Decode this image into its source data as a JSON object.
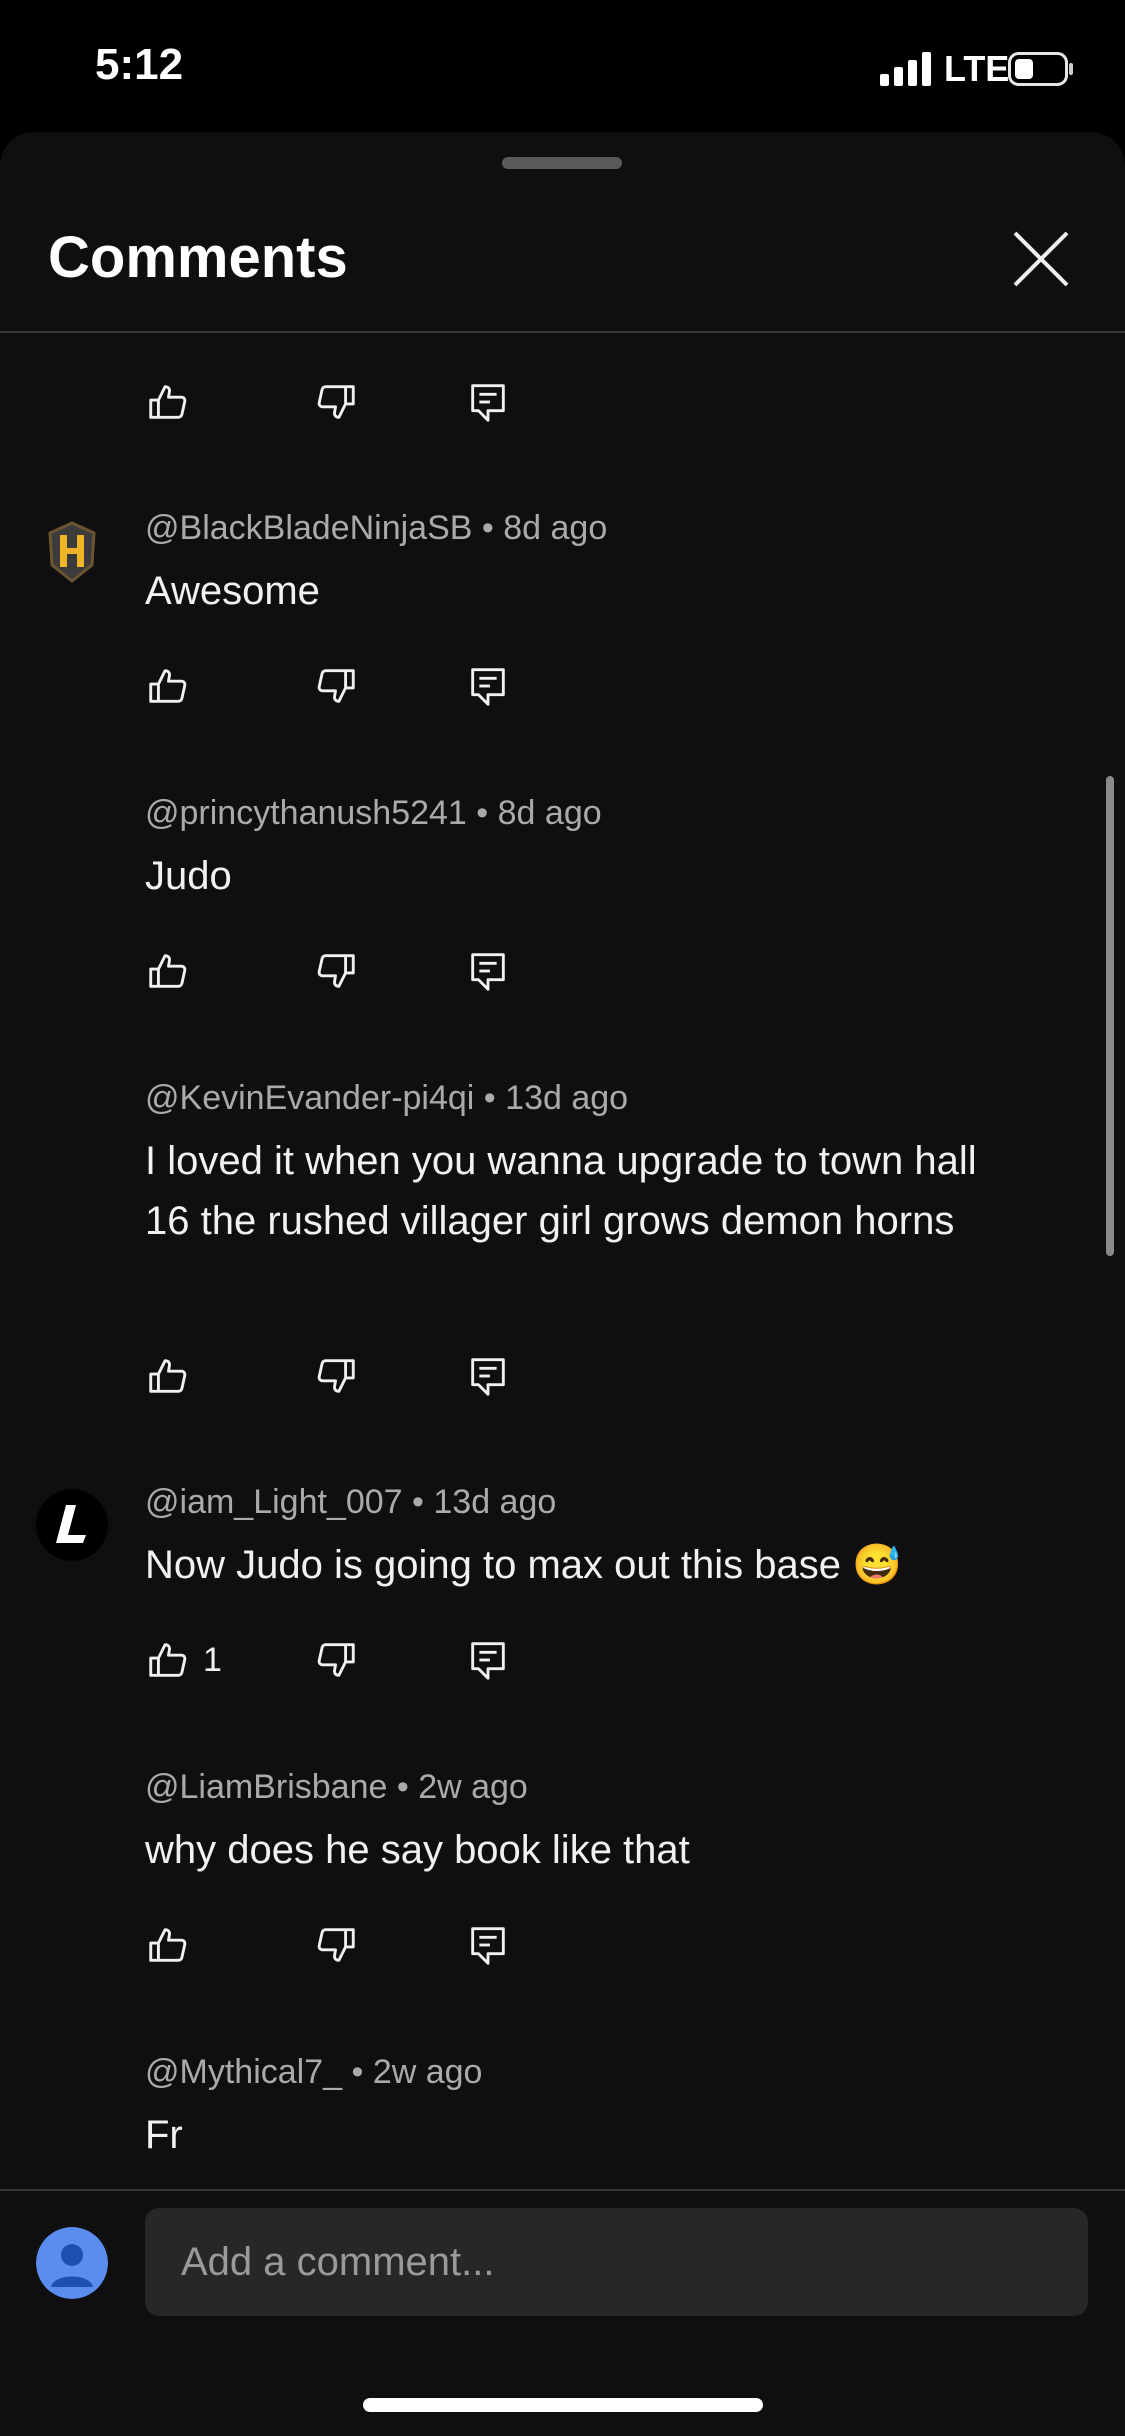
{
  "status_bar": {
    "time": "5:12",
    "network": "LTE"
  },
  "sheet": {
    "title": "Comments"
  },
  "comments": [
    {
      "user": "@BlackBladeNinjaSB",
      "age": "8d ago",
      "text": "Awesome"
    },
    {
      "user": "@princythanush5241",
      "age": "8d ago",
      "text": "Judo"
    },
    {
      "user": "@KevinEvander-pi4qi",
      "age": "13d ago",
      "text": "I loved it when you wanna upgrade to town hall 16 the rushed villager girl grows demon horns"
    },
    {
      "user": "@iam_Light_007",
      "age": "13d ago",
      "text": "Now Judo is going to max out this base 😅",
      "likes": "1"
    },
    {
      "user": "@LiamBrisbane",
      "age": "2w ago",
      "text": "why does he say book like that"
    },
    {
      "user": "@Mythical7_",
      "age": "2w ago",
      "text": "Fr"
    }
  ],
  "composer": {
    "placeholder": "Add a comment..."
  },
  "colors": {
    "background": "#0f0f0f",
    "text": "#f1f1f1",
    "secondary_text": "#aaaaaa",
    "input_bg": "#272727",
    "avatar_blue": "#5b8def"
  },
  "icons": [
    "thumb-up-icon",
    "thumb-down-icon",
    "reply-icon",
    "close-icon",
    "signal-icon",
    "battery-icon"
  ]
}
